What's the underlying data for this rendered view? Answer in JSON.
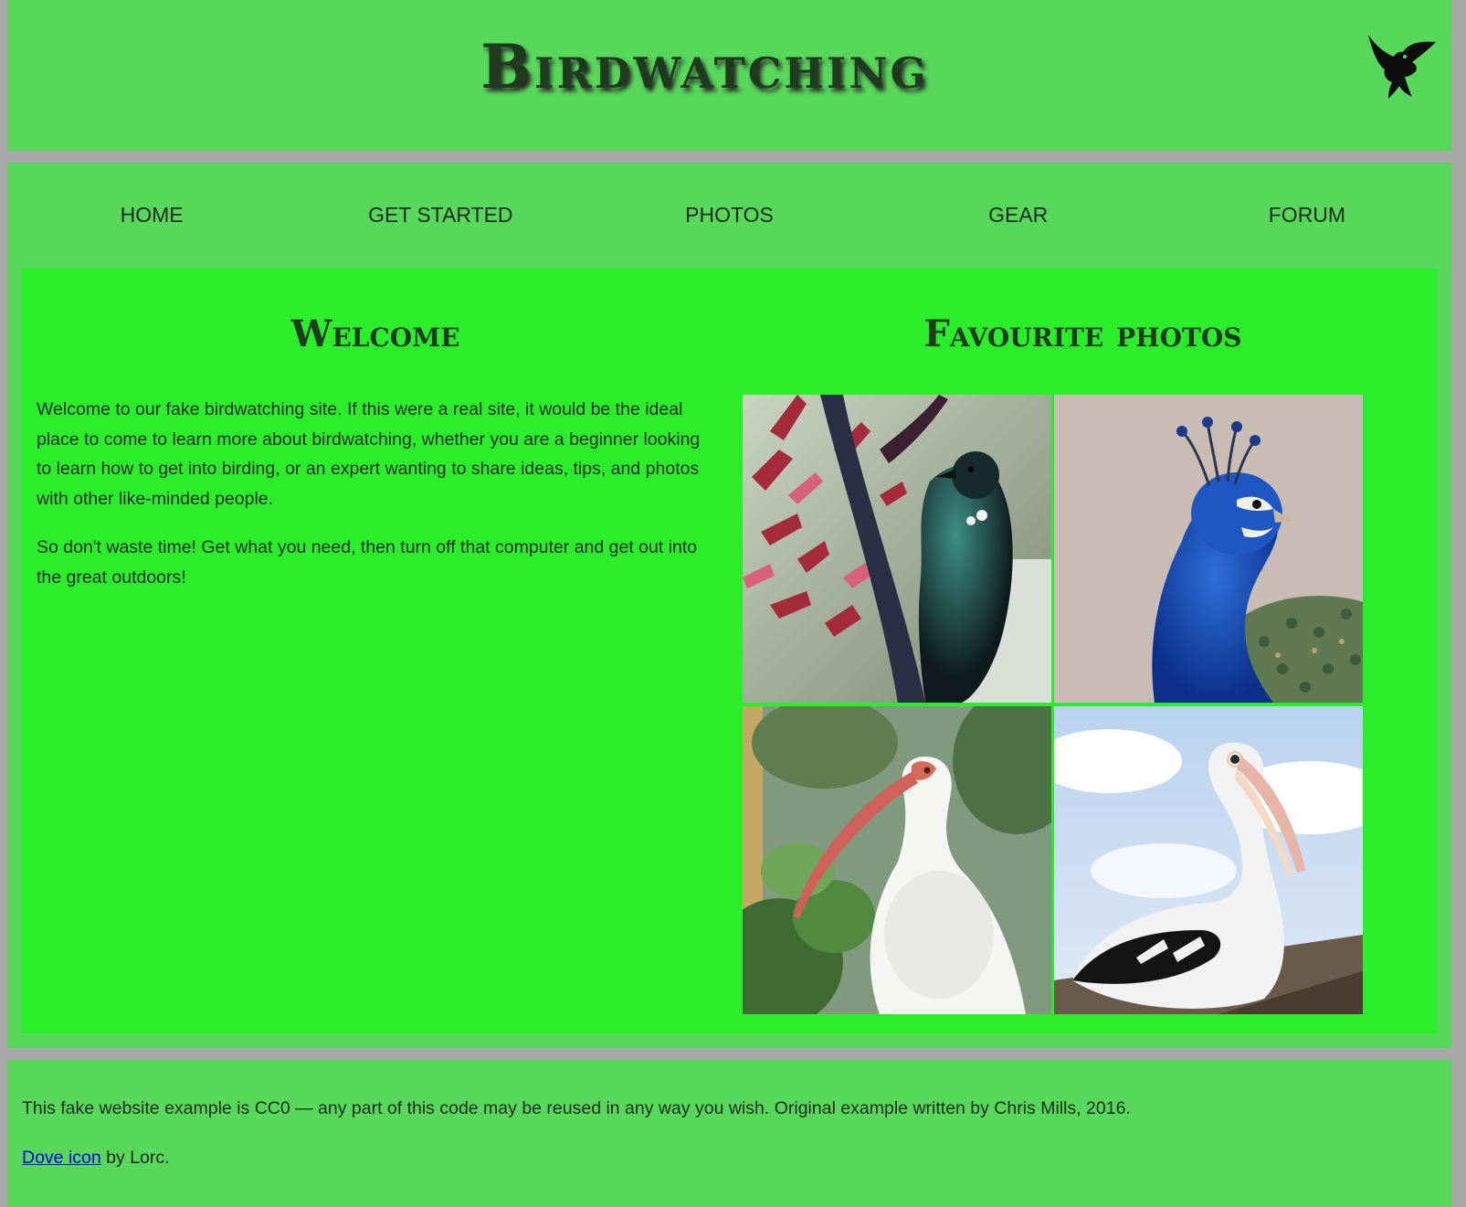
{
  "header": {
    "title": "Birdwatching",
    "logo_icon": "dove-icon"
  },
  "nav": {
    "items": [
      {
        "label": "Home"
      },
      {
        "label": "Get started"
      },
      {
        "label": "Photos"
      },
      {
        "label": "Gear"
      },
      {
        "label": "Forum"
      }
    ]
  },
  "main": {
    "welcome": {
      "heading": "Welcome",
      "paragraphs": [
        "Welcome to our fake birdwatching site. If this were a real site, it would be the ideal place to come to learn more about birdwatching, whether you are a beginner looking to learn how to get into birding, or an expert wanting to share ideas, tips, and photos with other like-minded people.",
        "So don't waste time! Get what you need, then turn off that computer and get out into the great outdoors!"
      ]
    },
    "photos": {
      "heading": "Favourite photos",
      "items": [
        {
          "subject": "tui-bird-photo"
        },
        {
          "subject": "peacock-photo"
        },
        {
          "subject": "white-ibis-photo"
        },
        {
          "subject": "pelican-photo"
        }
      ]
    }
  },
  "footer": {
    "license_text": "This fake website example is CC0 — any part of this code may be reused in any way you wish. Original example written by Chris Mills, 2016.",
    "credit_link_text": "Dove icon",
    "credit_suffix": " by Lorc."
  },
  "colors": {
    "page_background": "#a9a9a9",
    "section_background": "#57d85a",
    "main_background": "#2aee2a",
    "heading_text": "#1f3a1f",
    "body_text": "#1d2a1d",
    "link": "#0000ee"
  }
}
